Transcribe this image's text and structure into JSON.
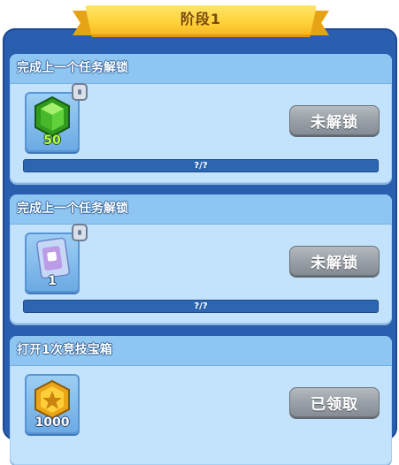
{
  "stage": {
    "title": "阶段1"
  },
  "tasks": [
    {
      "title": "完成上一个任务解锁",
      "reward": {
        "icon": "green-gem-icon",
        "count": "50"
      },
      "locked": true,
      "button_label": "未解锁",
      "progress": {
        "text": "?/?",
        "fraction": 0
      }
    },
    {
      "title": "完成上一个任务解锁",
      "reward": {
        "icon": "card-pack-icon",
        "count": "1"
      },
      "locked": true,
      "button_label": "未解锁",
      "progress": {
        "text": "?/?",
        "fraction": 0
      }
    },
    {
      "title": "打开1次竞技宝箱",
      "reward": {
        "icon": "gold-coin-icon",
        "count": "1000"
      },
      "locked": false,
      "button_label": "已领取"
    }
  ],
  "colors": {
    "panel": "#2a5fb0",
    "card": "#c3e2fb",
    "card_header": "#8fc6f1",
    "ribbon": "#ffd23a",
    "button_disabled": "#9aa0a7",
    "progress_track": "#2d66b0"
  }
}
